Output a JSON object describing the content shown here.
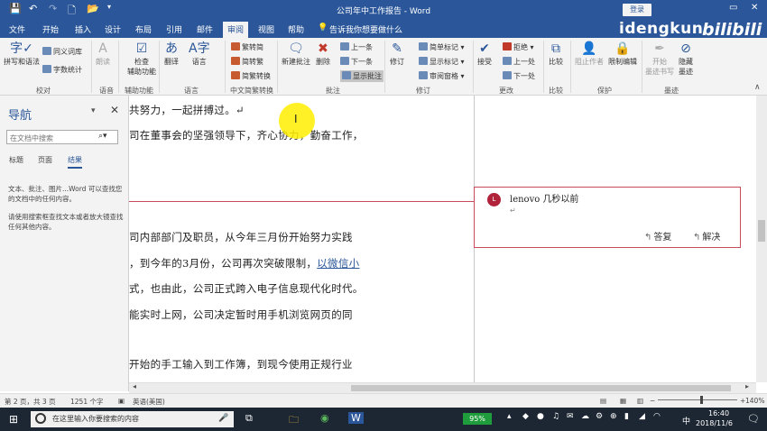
{
  "titlebar": {
    "title": "公司年中工作报告 - Word",
    "login": "登录",
    "quick_access": [
      "💾",
      "↶",
      "↷",
      "🗋",
      "📂",
      "▾"
    ],
    "restore": "▭",
    "close": "✕"
  },
  "menu": {
    "tabs": [
      "文件",
      "开始",
      "插入",
      "设计",
      "布局",
      "引用",
      "邮件",
      "审阅",
      "视图",
      "帮助"
    ],
    "active": "审阅",
    "tell_me": "告诉我你想要做什么"
  },
  "watermark": {
    "text": "idengkun",
    "bili": "bilibili"
  },
  "ribbon": {
    "proofing": {
      "spelling": "拼写和语法",
      "thesaurus": "同义词库",
      "word_count": "字数统计",
      "group": "校对"
    },
    "language_speech": {
      "read_aloud": "朗读",
      "group": "语音"
    },
    "accessibility": {
      "check": "检查",
      "check2": "辅助功能",
      "group": "辅助功能"
    },
    "language": {
      "translate": "翻译",
      "language": "语言",
      "group": "语言"
    },
    "chinese": {
      "trad": "繁转简",
      "simp": "简转繁",
      "convert": "简繁转换",
      "group": "中文简繁转换"
    },
    "comments": {
      "new": "新建批注",
      "delete": "删除",
      "prev": "上一条",
      "next": "下一条",
      "show": "显示批注",
      "group": "批注"
    },
    "tracking": {
      "track": "修订",
      "simple_markup": "简单标记",
      "show_markup": "显示标记",
      "review_pane": "审阅窗格",
      "group": "修订"
    },
    "changes": {
      "accept": "接受",
      "reject": "拒绝",
      "prev": "上一处",
      "next": "下一处",
      "group": "更改"
    },
    "compare": {
      "compare": "比较",
      "group": "比较"
    },
    "protect": {
      "block": "阻止作者",
      "restrict": "限制编辑",
      "group": "保护"
    },
    "ink": {
      "start": "开始",
      "start2": "墨迹书写",
      "hide": "隐藏",
      "hide2": "墨迹",
      "group": "墨迹"
    }
  },
  "nav": {
    "title": "导航",
    "search_placeholder": "在文档中搜索",
    "tabs": [
      "标题",
      "页面",
      "结果"
    ],
    "active_tab": "结果",
    "help1": "文本、批注、图片...Word 可以查找您的文档中的任何内容。",
    "help2": "请使用搜索框查找文本或者放大镜查找任何其他内容。"
  },
  "document": {
    "lines": [
      "共努力，一起拼搏过。↵",
      "司在董事会的坚强领导下，齐心协力，勤奋工作，",
      "司内部部门及职员，从今年三月份开始努力实践",
      "，到今年的3月份，公司再次突破限制，",
      "式，也由此，公司正式跨入电子信息现代化时代。",
      "能实时上网，公司决定暂时用手机浏览网页的同",
      "开始的手工输入到工作簿，到现今使用正规行业"
    ],
    "link": "以微信小",
    "pilcrow": "↵",
    "ibeam": "I"
  },
  "comment": {
    "avatar": "L",
    "author": "lenovo",
    "time": "几秒以前",
    "para": "↵",
    "reply": "答复",
    "resolve": "解决"
  },
  "statusbar": {
    "page": "第 2 页，共 3 页",
    "words": "1251 个字",
    "lang": "英语(美国)",
    "zoom": "140%"
  },
  "taskbar": {
    "search": "在这里输入你要搜索的内容",
    "battery": "95%",
    "time": "16:40",
    "date": "2018/11/6",
    "ime": "中"
  }
}
